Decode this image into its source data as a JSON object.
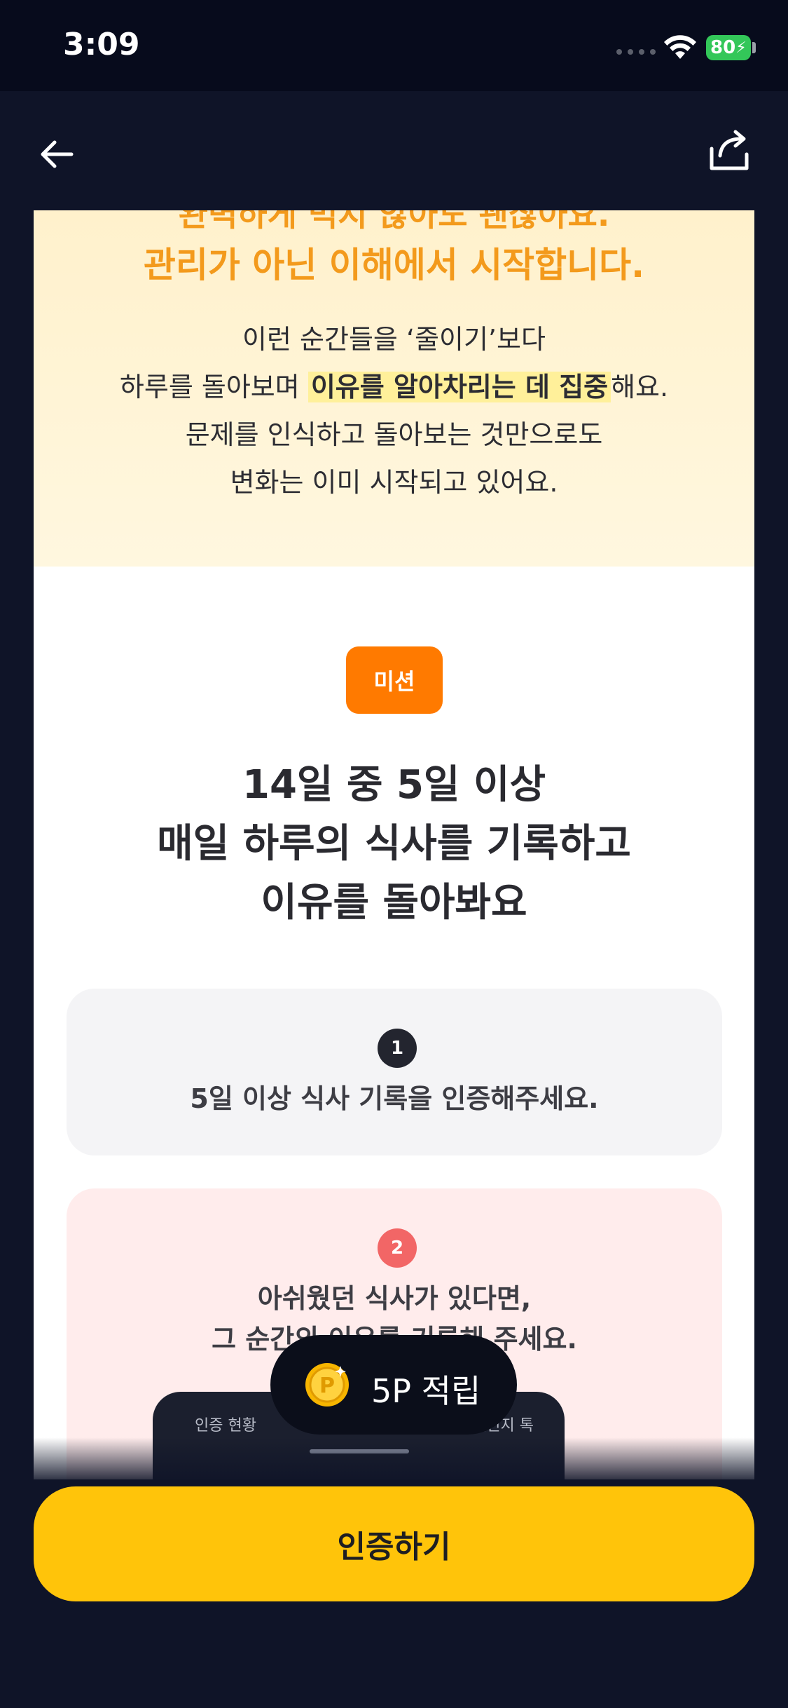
{
  "status_bar": {
    "time": "3:09",
    "battery": "80"
  },
  "intro": {
    "cut_heading": "완벽하게 먹지 않아도 괜찮아요.",
    "heading": "관리가 아닌 이해에서 시작합니다.",
    "line1": "이런 순간들을 ‘줄이기’보다",
    "line2_prefix": "하루를 돌아보며 ",
    "line2_highlight": "이유를 알아차리는 데 집중",
    "line2_suffix": "해요.",
    "line3": "문제를 인식하고 돌아보는 것만으로도",
    "line4": "변화는 이미 시작되고 있어요."
  },
  "mission": {
    "badge": "미션",
    "title_line1": "14일 중 5일 이상",
    "title_line2": "매일 하루의 식사를 기록하고",
    "title_line3": "이유를 돌아봐요"
  },
  "steps": [
    {
      "number": "1",
      "text_line1": "5일 이상 식사 기록을 인증해주세요."
    },
    {
      "number": "2",
      "text_line1": "아쉬웠던 식사가 있다면,",
      "text_line2": "그 순간의 이유를 기록해 주세요."
    }
  ],
  "preview": {
    "tab_left": "인증 현황",
    "tab_right": "챌린지 톡"
  },
  "toast": {
    "points": "5P 적립",
    "coin_label": "P"
  },
  "cta": {
    "label": "인증하기"
  },
  "colors": {
    "accent": "#ff7a00",
    "cta": "#ffc40a",
    "heading": "#f39a1c",
    "background": "#0f1428"
  }
}
